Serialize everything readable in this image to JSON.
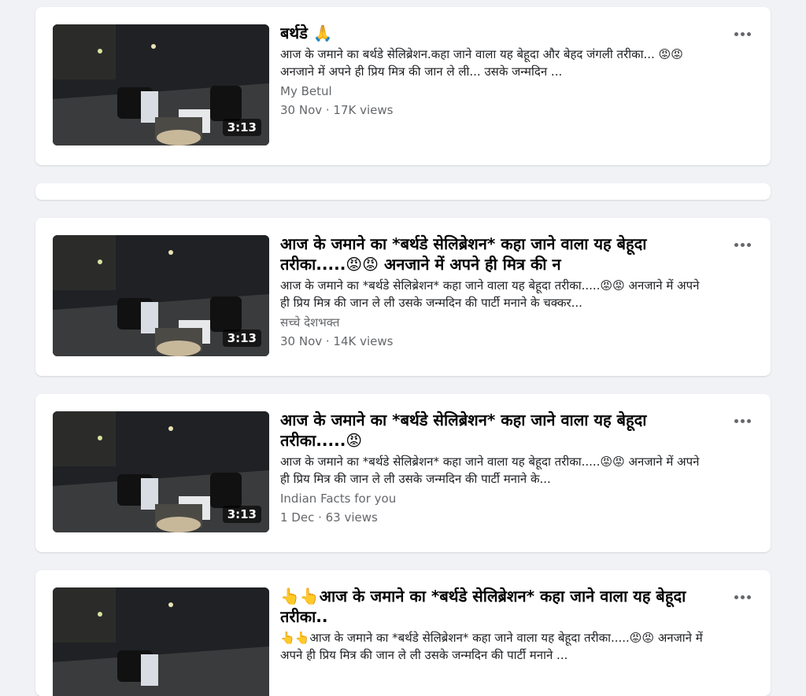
{
  "feed": {
    "videos": [
      {
        "title": "बर्थडे 🙏",
        "description": "आज के जमाने का बर्थडे सेलिब्रेशन.कहा जाने वाला यह बेहूदा और बेहद जंगली तरीका... 😡😡 अनजाने में अपने ही प्रिय मित्र की जान ले ली... उसके जन्मदिन ...",
        "channel": "My Betul",
        "meta": "30 Nov · 17K views",
        "duration": "3:13"
      },
      {
        "title": "आज के जमाने का *बर्थडे सेलिब्रेशन* कहा जाने वाला यह बेहूदा तरीका.....😡😡 अनजाने में अपने ही मित्र की न",
        "description": "आज के जमाने का *बर्थडे सेलिब्रेशन* कहा जाने वाला यह बेहूदा तरीका.....😡😡 अनजाने में अपने ही प्रिय मित्र की जान ले ली उसके जन्मदिन की पार्टी मनाने के चक्कर...",
        "channel": "सच्चे देशभक्त",
        "meta": "30 Nov · 14K views",
        "duration": "3:13"
      },
      {
        "title": "आज के जमाने का *बर्थडे सेलिब्रेशन* कहा जाने वाला यह बेहूदा तरीका.....😡",
        "description": "आज के जमाने का *बर्थडे सेलिब्रेशन* कहा जाने वाला यह बेहूदा तरीका.....😡😡 अनजाने में अपने ही प्रिय मित्र की जान ले ली उसके जन्मदिन की पार्टी मनाने के...",
        "channel": "Indian Facts for you",
        "meta": "1 Dec · 63 views",
        "duration": "3:13"
      },
      {
        "title": "👆👆आज के जमाने का *बर्थडे सेलिब्रेशन* कहा जाने वाला यह बेहूदा तरीका..",
        "description": "👆👆आज के जमाने का *बर्थडे सेलिब्रेशन* कहा जाने वाला यह बेहूदा तरीका.....😡😡 अनजाने में अपने ही प्रिय मित्र की जान ले ली उसके जन्मदिन की पार्टी मनाने ...",
        "channel": "",
        "meta": "",
        "duration": ""
      }
    ]
  },
  "colors": {
    "background": "#f0f2f5",
    "card": "#ffffff",
    "secondary_text": "#65676b"
  },
  "icons": {
    "more": "more-options-icon"
  }
}
